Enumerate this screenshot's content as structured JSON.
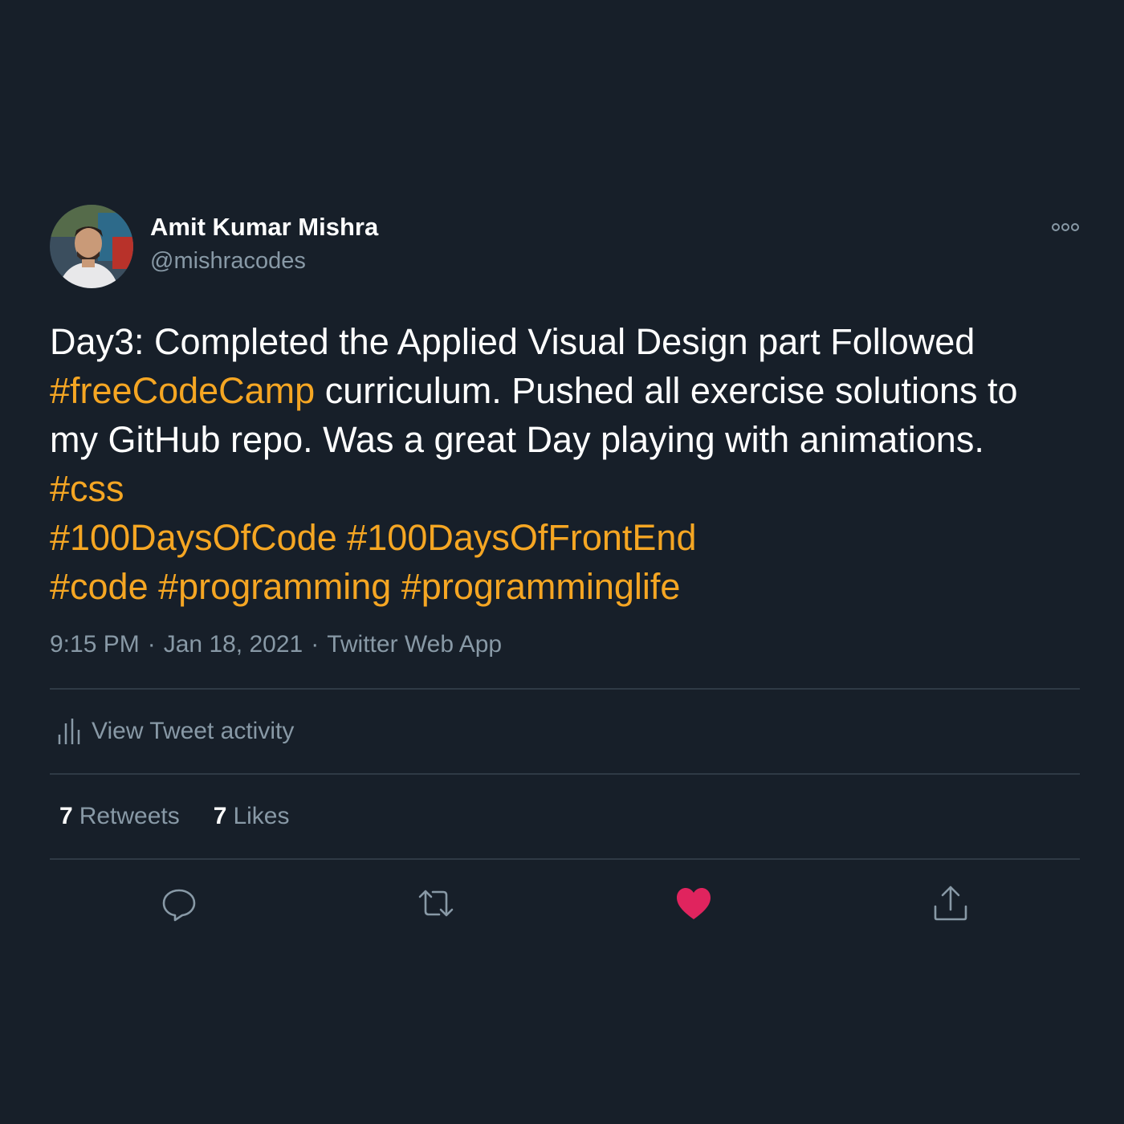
{
  "author": {
    "display_name": "Amit Kumar Mishra",
    "handle": "@mishracodes"
  },
  "tweet": {
    "lines": [
      [
        {
          "t": "Day3: Completed the Applied Visual Design part Followed",
          "tag": false
        }
      ],
      [
        {
          "t": "#freeCodeCamp",
          "tag": true
        },
        {
          "t": " curriculum. Pushed all exercise solutions to",
          "tag": false
        }
      ],
      [
        {
          "t": "my GitHub repo. Was a great Day playing with animations.",
          "tag": false
        }
      ],
      [
        {
          "t": "#css",
          "tag": true
        }
      ],
      [
        {
          "t": "#100DaysOfCode",
          "tag": true
        },
        {
          "t": " ",
          "tag": false
        },
        {
          "t": "#100DaysOfFrontEnd",
          "tag": true
        }
      ],
      [
        {
          "t": "#code",
          "tag": true
        },
        {
          "t": " ",
          "tag": false
        },
        {
          "t": "#programming",
          "tag": true
        },
        {
          "t": " ",
          "tag": false
        },
        {
          "t": "#programminglife",
          "tag": true
        }
      ]
    ],
    "time": "9:15 PM",
    "date": "Jan 18, 2021",
    "separator": "·",
    "source": "Twitter Web App"
  },
  "activity": {
    "label": "View Tweet activity",
    "icon": "bar-chart-icon"
  },
  "stats": {
    "retweets_count": "7",
    "retweets_label": "Retweets",
    "likes_count": "7",
    "likes_label": "Likes"
  },
  "actions": {
    "reply_icon": "reply-icon",
    "retweet_icon": "retweet-icon",
    "like_icon": "heart-icon",
    "liked": true,
    "share_icon": "share-icon"
  },
  "colors": {
    "background": "#171f29",
    "hashtag": "#f5a623",
    "secondary_text": "#8899a6",
    "like_active": "#e0245e",
    "divider": "#2f3a45"
  }
}
